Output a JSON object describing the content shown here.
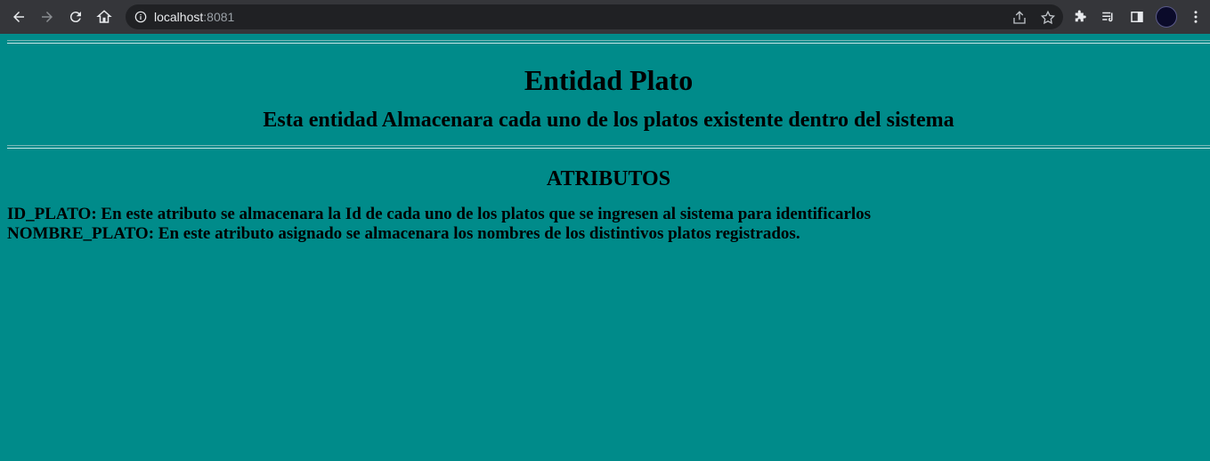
{
  "browser": {
    "url_host": "localhost",
    "url_port": ":8081"
  },
  "page": {
    "title": "Entidad Plato",
    "subtitle": "Esta entidad Almacenara cada uno de los platos existente dentro del sistema",
    "section_title": "ATRIBUTOS",
    "attributes": [
      "ID_PLATO: En este atributo se almacenara la Id de cada uno de los platos que se ingresen al sistema para identificarlos",
      "NOMBRE_PLATO: En este atributo asignado se almacenara los nombres de los distintivos platos registrados."
    ]
  },
  "colors": {
    "page_background": "#008b8a",
    "toolbar_background": "#35363a",
    "omnibox_background": "#202124"
  }
}
